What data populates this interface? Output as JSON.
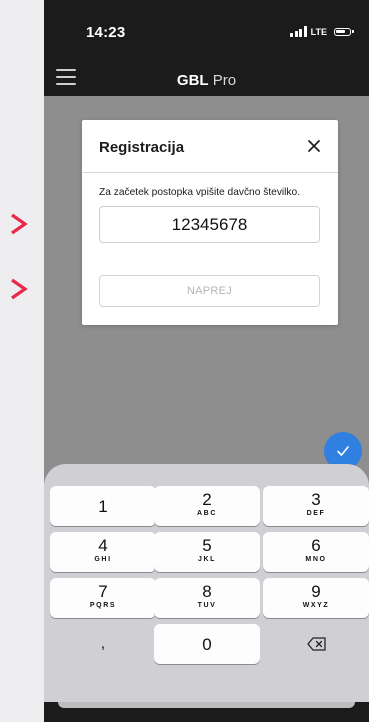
{
  "status_bar": {
    "time": "14:23",
    "network": "LTE"
  },
  "app": {
    "title_bold": "GBL",
    "title_rest": " Pro"
  },
  "dialog": {
    "title": "Registracija",
    "instruction": "Za začetek postopka vpišite davčno številko.",
    "tax_number_value": "12345678",
    "next_label": "NAPREJ"
  },
  "keyboard": {
    "keys": [
      {
        "digit": "1",
        "letters": ""
      },
      {
        "digit": "2",
        "letters": "ABC"
      },
      {
        "digit": "3",
        "letters": "DEF"
      },
      {
        "digit": "4",
        "letters": "GHI"
      },
      {
        "digit": "5",
        "letters": "JKL"
      },
      {
        "digit": "6",
        "letters": "MNO"
      },
      {
        "digit": "7",
        "letters": "PQRS"
      },
      {
        "digit": "8",
        "letters": "TUV"
      },
      {
        "digit": "9",
        "letters": "WXYZ"
      },
      {
        "digit": ",",
        "letters": ""
      },
      {
        "digit": "0",
        "letters": ""
      },
      {
        "digit": "",
        "letters": ""
      }
    ]
  },
  "colors": {
    "accent_chevron": "#e8294a",
    "fab_blue": "#2f80e0",
    "dark_bar": "#1b1b1b",
    "overlay": "#8e8e8e"
  },
  "icons": {
    "left_markers": "chevron-right-icon",
    "menu": "hamburger-menu-icon",
    "close": "close-icon",
    "fab": "checkmark-icon",
    "delete": "backspace-icon"
  }
}
